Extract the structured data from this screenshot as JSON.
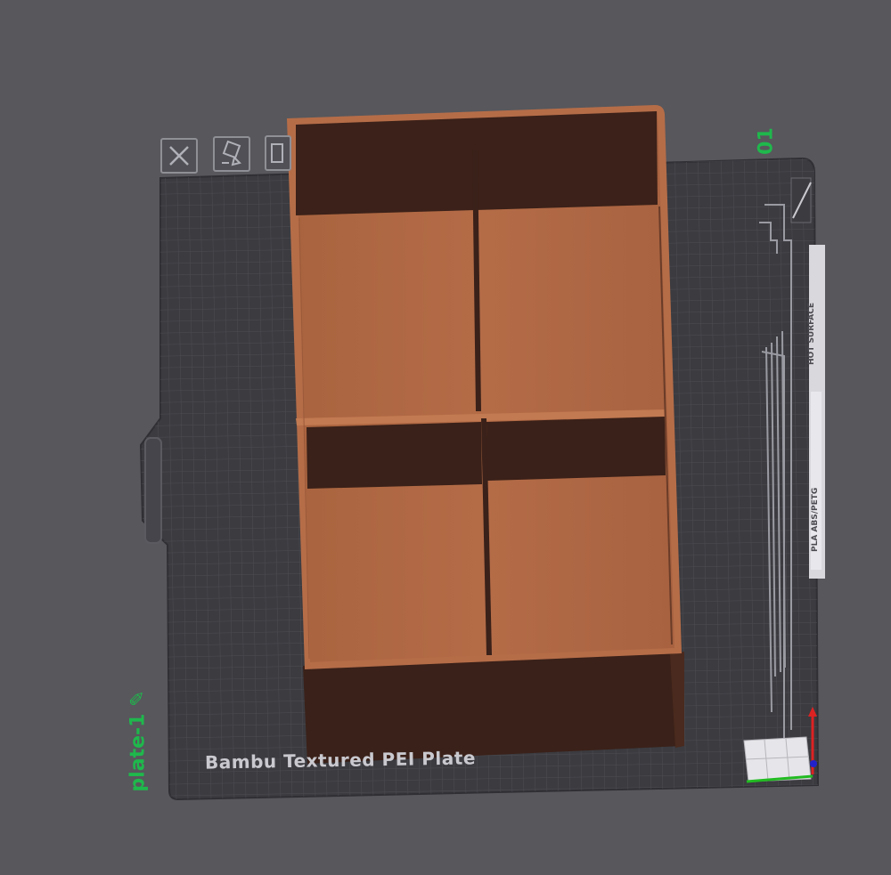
{
  "plate": {
    "name": "plate-1",
    "number": "01",
    "bed_label": "Bambu Textured PEI Plate",
    "strip_surface": "HOT SURFACE",
    "strip_material": "PLA ABS/PETG"
  },
  "toolbar": {
    "buttons": [
      {
        "name": "close-plate-button",
        "icon": "close-icon"
      },
      {
        "name": "auto-orient-button",
        "icon": "auto-orient-icon"
      },
      {
        "name": "arrange-button",
        "icon": "arrange-icon"
      }
    ]
  },
  "model": {
    "name": "four-compartment-box",
    "color": "#b06a45"
  },
  "colors": {
    "background": "#57575c",
    "bed": "#3b3b40",
    "grid": "#4a4a50",
    "accent": "#1fb84c",
    "model_light": "#b06a45",
    "model_dark": "#3a2119"
  }
}
